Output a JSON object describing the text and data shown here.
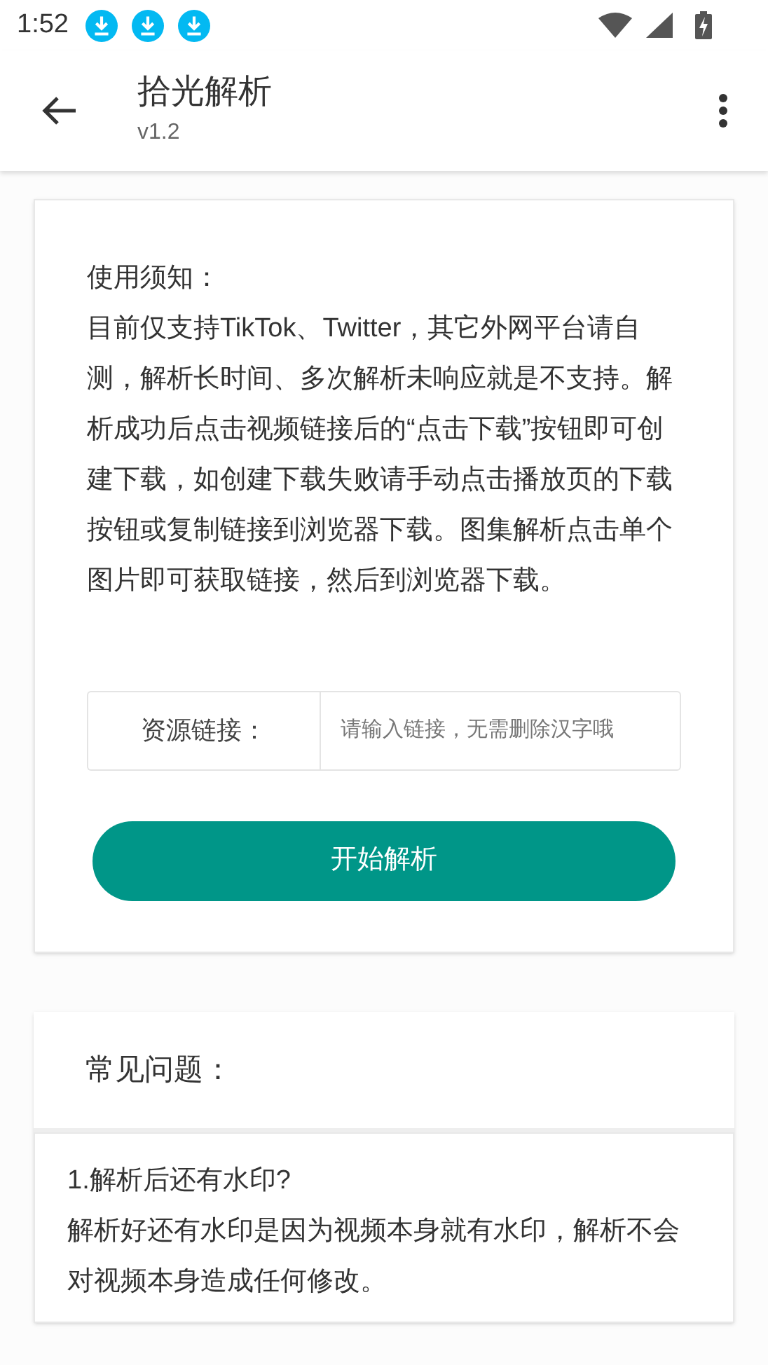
{
  "status_bar": {
    "time": "1:52",
    "notifications": [
      {
        "kind": "download"
      },
      {
        "kind": "download"
      },
      {
        "kind": "download"
      }
    ]
  },
  "app_bar": {
    "title": "拾光解析",
    "subtitle": "v1.2"
  },
  "notice": {
    "heading": "使用须知：",
    "body": "目前仅支持TikTok、Twitter，其它外网平台请自测，解析长时间、多次解析未响应就是不支持。解析成功后点击视频链接后的“点击下载”按钮即可创建下载，如创建下载失败请手动点击播放页的下载按钮或复制链接到浏览器下载。图集解析点击单个图片即可获取链接，然后到浏览器下载。"
  },
  "link_input": {
    "label": "资源链接：",
    "placeholder": "请输入链接，无需删除汉字哦"
  },
  "parse_button": "开始解析",
  "faq": {
    "title": "常见问题：",
    "items": [
      {
        "question": "1.解析后还有水印?",
        "answer": "解析好还有水印是因为视频本身就有水印，解析不会对视频本身造成任何修改。"
      }
    ]
  }
}
